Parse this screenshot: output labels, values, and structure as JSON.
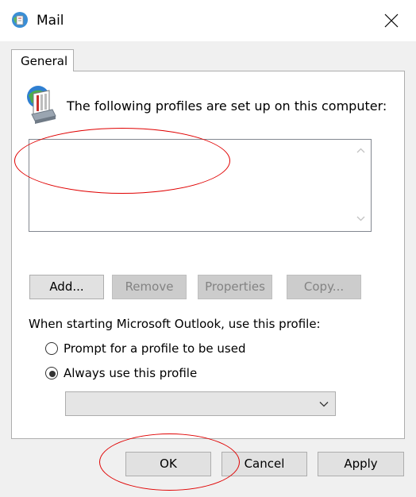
{
  "window": {
    "title": "Mail",
    "icon": "mail-profile-icon"
  },
  "tabs": [
    {
      "label": "General",
      "selected": true
    }
  ],
  "profiles": {
    "heading": "The following profiles are set up on this computer:",
    "icon": "profiles-icon",
    "items": []
  },
  "list_buttons": {
    "add": "Add...",
    "remove": "Remove",
    "properties": "Properties",
    "copy": "Copy..."
  },
  "startup": {
    "label": "When starting Microsoft Outlook, use this profile:",
    "options": [
      {
        "label": "Prompt for a profile to be used",
        "checked": false
      },
      {
        "label": "Always use this profile",
        "checked": true
      }
    ],
    "selected_profile": ""
  },
  "footer": {
    "ok": "OK",
    "cancel": "Cancel",
    "apply": "Apply"
  },
  "colors": {
    "annotation": "#e00000",
    "dialog_bg": "#f0f0f0",
    "button_bg": "#e1e1e1",
    "disabled_text": "#838383"
  }
}
